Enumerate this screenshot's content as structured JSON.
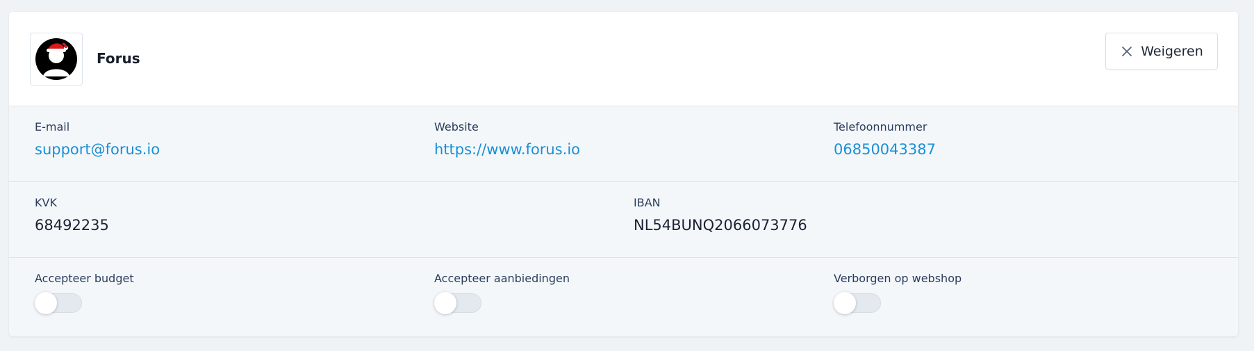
{
  "organization": {
    "name": "Forus",
    "logo_icon": "avatar-santa-hat-icon"
  },
  "actions": {
    "reject_label": "Weigeren",
    "reject_icon": "close-icon"
  },
  "contact": {
    "email_label": "E-mail",
    "email_value": "support@forus.io",
    "website_label": "Website",
    "website_value": "https://www.forus.io",
    "phone_label": "Telefoonnummer",
    "phone_value": "06850043387"
  },
  "company": {
    "kvk_label": "KVK",
    "kvk_value": "68492235",
    "iban_label": "IBAN",
    "iban_value": "NL54BUNQ2066073776"
  },
  "settings": {
    "accept_budget_label": "Accepteer budget",
    "accept_budget_on": false,
    "accept_products_label": "Accepteer aanbiedingen",
    "accept_products_on": false,
    "hidden_webshop_label": "Verborgen op webshop",
    "hidden_webshop_on": false
  },
  "colors": {
    "link": "#1a8fd6",
    "card_background": "#f4f7fa",
    "header_background": "#ffffff"
  }
}
